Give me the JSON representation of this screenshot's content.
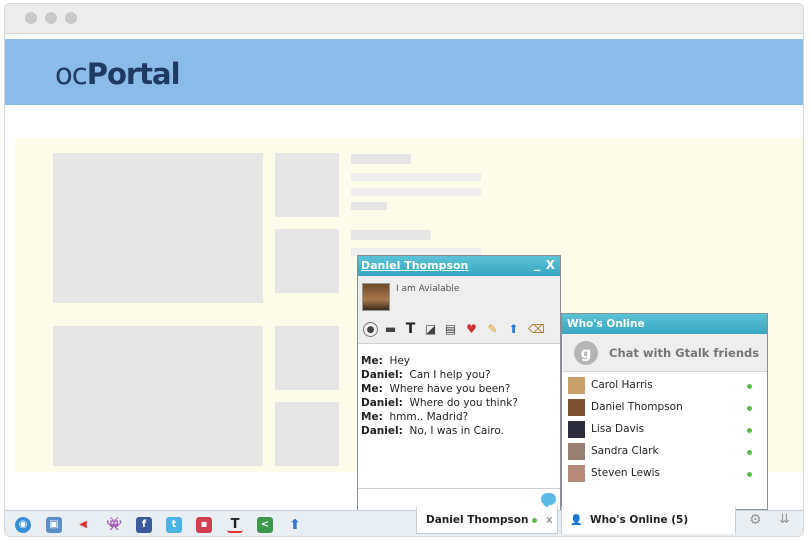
{
  "app": {
    "logo_prefix": "oc",
    "logo_suffix": "Portal"
  },
  "chat_window": {
    "contact_name": "Daniel Thompson",
    "status_text": "I am Avialable",
    "minimize_symbol": "_",
    "close_symbol": "X",
    "toolbar_icons": [
      "webcam-icon",
      "screen-share-icon",
      "text-format-icon",
      "whiteboard-icon",
      "notes-icon",
      "cards-icon",
      "pencil-icon",
      "upload-icon",
      "clear-icon"
    ],
    "messages": [
      {
        "sender": "Me:",
        "text": "Hey"
      },
      {
        "sender": "Daniel:",
        "text": "Can I help you?"
      },
      {
        "sender": "Me:",
        "text": "Where have you been?"
      },
      {
        "sender": "Daniel:",
        "text": "Where do you think?"
      },
      {
        "sender": "Me:",
        "text": "hmm.. Madrid?"
      },
      {
        "sender": "Daniel:",
        "text": "No, I was in Cairo."
      }
    ]
  },
  "chat_tab": {
    "label": "Daniel Thompson",
    "close": "x"
  },
  "whos_online": {
    "title": "Who's Online",
    "gtalk_label": "Chat with Gtalk friends",
    "gtalk_icon_letter": "g",
    "friends": [
      {
        "name": "Carol Harris",
        "avatar_color": "#c9a06a"
      },
      {
        "name": "Daniel Thompson",
        "avatar_color": "#7a5232"
      },
      {
        "name": "Lisa Davis",
        "avatar_color": "#2b2b3a"
      },
      {
        "name": "Sandra Clark",
        "avatar_color": "#9a8070"
      },
      {
        "name": "Steven Lewis",
        "avatar_color": "#b58a7a"
      }
    ],
    "tab_label": "Who's Online (5)"
  },
  "bottom_bar": {
    "icons": [
      "globe-icon",
      "widget-icon",
      "megaphone-icon",
      "space-invader-icon",
      "facebook-icon",
      "twitter-icon",
      "app-icon",
      "text-icon",
      "share-icon",
      "upload-arrow-icon"
    ]
  },
  "colors": {
    "header": "#8bbbe8",
    "chat_accent": "#36a6bf",
    "online": "#5dbb4a",
    "logo": "#1f3b63"
  }
}
